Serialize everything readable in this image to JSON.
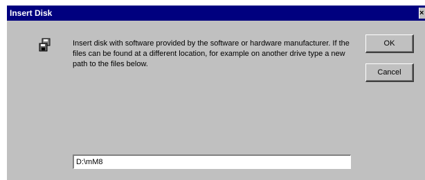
{
  "window": {
    "title": "Insert Disk",
    "close_glyph": "×"
  },
  "message": "Insert disk with software provided by the software or hardware manufacturer. If the files can be found at a different location, for example on another drive type a new path to the files below.",
  "buttons": {
    "ok_label": "OK",
    "cancel_label": "Cancel"
  },
  "path_input": {
    "value": "D:\\mM8"
  },
  "icons": {
    "dialog_icon": "disk-icon"
  },
  "colors": {
    "titlebar": "#00007f",
    "dialog_bg": "#c0c0c0"
  }
}
